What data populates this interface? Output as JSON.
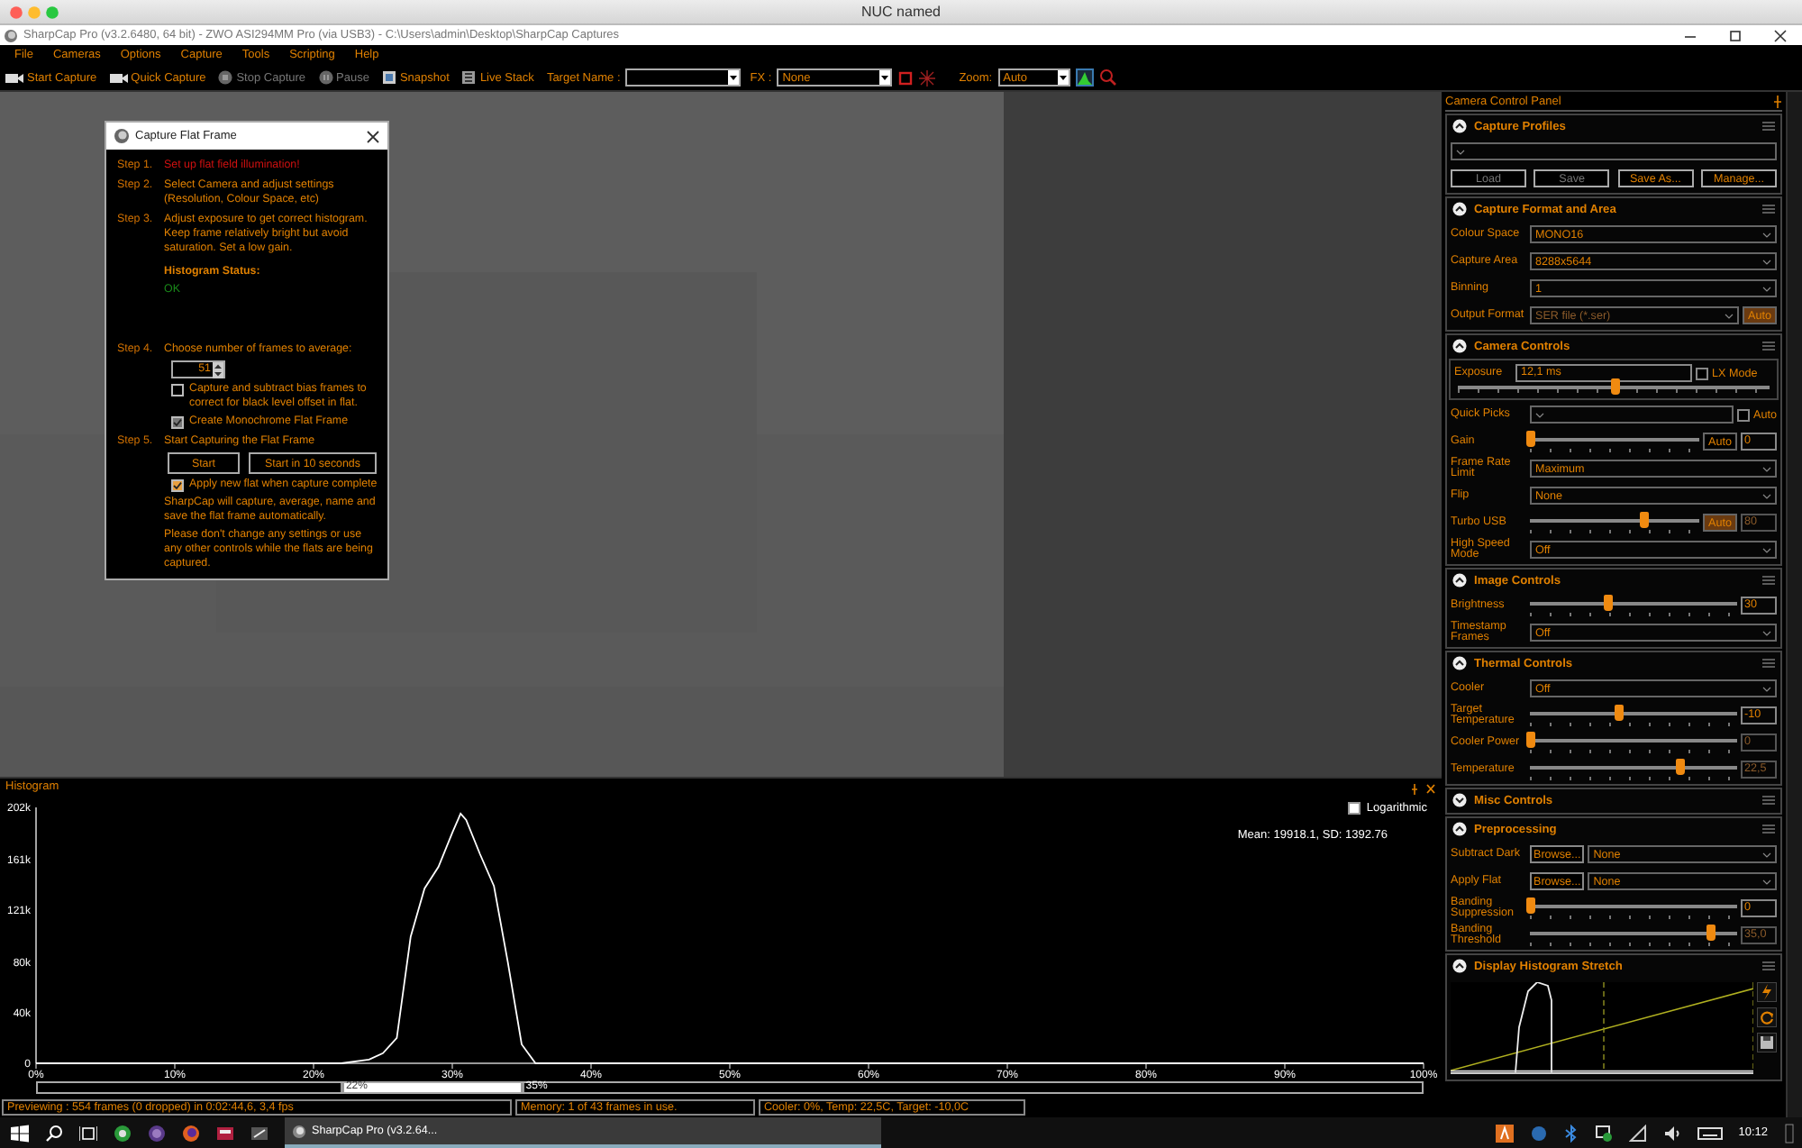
{
  "mac_title": "NUC named",
  "window": {
    "title": "SharpCap Pro (v3.2.6480, 64 bit) - ZWO ASI294MM Pro (via USB3) - C:\\Users\\admin\\Desktop\\SharpCap Captures"
  },
  "menu": [
    "File",
    "Cameras",
    "Options",
    "Capture",
    "Tools",
    "Scripting",
    "Help"
  ],
  "toolbar": {
    "buttons": [
      {
        "kind": "camera",
        "label": "Start Capture",
        "disabled": false
      },
      {
        "kind": "camera",
        "label": "Quick Capture",
        "disabled": false
      },
      {
        "kind": "stop",
        "label": "Stop Capture",
        "disabled": true
      },
      {
        "kind": "pause",
        "label": "Pause",
        "disabled": true
      },
      {
        "kind": "snapshot",
        "label": "Snapshot",
        "disabled": false
      },
      {
        "kind": "stack",
        "label": "Live Stack",
        "disabled": false
      }
    ],
    "target": {
      "label": "Target Name :"
    },
    "fx": {
      "label": "FX :",
      "value": "None"
    },
    "zoom": {
      "label": "Zoom:",
      "value": "Auto"
    }
  },
  "dialog": {
    "title": "Capture Flat Frame",
    "steps": [
      {
        "label": "Step 1.",
        "text": "Set up flat field illumination!",
        "warning": true
      },
      {
        "label": "Step 2.",
        "text": "Select Camera and adjust settings (Resolution, Colour Space, etc)",
        "warning": false
      },
      {
        "label": "Step 3.",
        "text": "Adjust exposure to get correct histogram. Keep frame relatively bright but avoid saturation. Set a low gain.",
        "warning": false,
        "status_label": "Histogram Status:",
        "status_value": "OK"
      },
      {
        "label": "Step 4.",
        "text": "Choose number of frames to average:",
        "warning": false,
        "frames": "51",
        "options": [
          {
            "label": "Capture and subtract bias frames to correct for black level offset in flat.",
            "checked": false,
            "disabled": false
          },
          {
            "label": "Create Monochrome Flat Frame",
            "checked": true,
            "disabled": true
          }
        ]
      },
      {
        "label": "Step 5.",
        "text": "Start Capturing the Flat Frame",
        "warning": false,
        "buttons": [
          "Start",
          "Start in 10 seconds"
        ],
        "options": [
          {
            "label": "Apply new flat when capture complete",
            "checked": true,
            "disabled": false
          }
        ],
        "notes": [
          "SharpCap will capture, average, name and save the flat frame automatically.",
          "Please don't change any settings or use any other controls while the flats are being captured."
        ]
      }
    ]
  },
  "histogram": {
    "title": "Histogram",
    "logarithmic": {
      "label": "Logarithmic",
      "checked": false
    },
    "stats": "Mean: 19918.1, SD: 1392.76",
    "chart_data": {
      "type": "line",
      "x": [
        0,
        22,
        24,
        25,
        26,
        27,
        28,
        29,
        30,
        30.6,
        31,
        32,
        33,
        34,
        35,
        36,
        100
      ],
      "series": [
        {
          "color": "#ffffff",
          "values": [
            0,
            0,
            3,
            8,
            20,
            100,
            138,
            155,
            182,
            197,
            192,
            165,
            140,
            80,
            15,
            0,
            0
          ]
        }
      ],
      "xlim": [
        0,
        100
      ],
      "ylim": [
        0,
        202
      ],
      "xticks": [
        {
          "value": 0,
          "label": "0%"
        },
        {
          "value": 10,
          "label": "10%"
        },
        {
          "value": 20,
          "label": "20%"
        },
        {
          "value": 30,
          "label": "30%"
        },
        {
          "value": 40,
          "label": "40%"
        },
        {
          "value": 50,
          "label": "50%"
        },
        {
          "value": 60,
          "label": "60%"
        },
        {
          "value": 70,
          "label": "70%"
        },
        {
          "value": 80,
          "label": "80%"
        },
        {
          "value": 90,
          "label": "90%"
        },
        {
          "value": 100,
          "label": "100%"
        }
      ],
      "yticks": [
        {
          "value": 0,
          "label": "0"
        },
        {
          "value": 40,
          "label": "40k"
        },
        {
          "value": 80,
          "label": "80k"
        },
        {
          "value": 121,
          "label": "121k"
        },
        {
          "value": 161,
          "label": "161k"
        },
        {
          "value": 202,
          "label": "202k"
        }
      ]
    },
    "range": {
      "start": {
        "label": "22%",
        "level": 0.22
      },
      "end": {
        "label": "35%",
        "level": 0.35
      }
    }
  },
  "status_bar": [
    "Previewing : 554 frames (0 dropped) in 0:02:44,6, 3,4 fps",
    "Memory: 1 of 43 frames in use.",
    "Cooler: 0%, Temp: 22,5C, Target: -10,0C"
  ],
  "panel": {
    "title": "Camera Control Panel",
    "sections": [
      {
        "title": "Capture Profiles",
        "expanded": true,
        "rows": [
          {
            "kind": "select",
            "disabled": false
          },
          {
            "kind": "buttons",
            "buttons": [
              {
                "label": "Load",
                "disabled": true
              },
              {
                "label": "Save",
                "disabled": true
              },
              {
                "label": "Save As...",
                "disabled": false
              },
              {
                "label": "Manage...",
                "disabled": false
              }
            ]
          }
        ]
      },
      {
        "title": "Capture Format and Area",
        "expanded": true,
        "rows": [
          {
            "kind": "select",
            "label": "Colour Space",
            "value": "MONO16",
            "disabled": false
          },
          {
            "kind": "select",
            "label": "Capture Area",
            "value": "8288x5644",
            "disabled": false
          },
          {
            "kind": "select",
            "label": "Binning",
            "value": "1",
            "disabled": false
          },
          {
            "kind": "select",
            "label": "Output Format",
            "value": "SER file (*.ser)",
            "disabled": true,
            "auto": {
              "label": "Auto",
              "on": true
            }
          }
        ]
      },
      {
        "title": "Camera Controls",
        "expanded": true,
        "rows": [
          {
            "kind": "exposure",
            "label": "Exposure",
            "value": "12,1 ms",
            "check": {
              "label": "LX Mode",
              "checked": false
            },
            "level": 0.5
          },
          {
            "kind": "select",
            "label": "Quick Picks",
            "disabled": false,
            "check": {
              "label": "Auto",
              "checked": false
            }
          },
          {
            "kind": "slider",
            "label": "Gain",
            "level": 0,
            "auto": {
              "label": "Auto",
              "on": false
            },
            "value": "0",
            "disabled": false
          },
          {
            "kind": "select",
            "label": "Frame Rate Limit",
            "value": "Maximum",
            "disabled": false
          },
          {
            "kind": "select",
            "label": "Flip",
            "value": "None",
            "disabled": false
          },
          {
            "kind": "slider",
            "label": "Turbo USB",
            "level": 0.67,
            "auto": {
              "label": "Auto",
              "on": true
            },
            "value": "80",
            "disabled": true
          },
          {
            "kind": "select",
            "label": "High Speed Mode",
            "value": "Off",
            "disabled": false
          }
        ]
      },
      {
        "title": "Image Controls",
        "expanded": true,
        "rows": [
          {
            "kind": "slider",
            "label": "Brightness",
            "level": 0.37,
            "value": "30",
            "disabled": false
          },
          {
            "kind": "select",
            "label": "Timestamp Frames",
            "value": "Off",
            "disabled": false
          }
        ]
      },
      {
        "title": "Thermal Controls",
        "expanded": true,
        "rows": [
          {
            "kind": "select",
            "label": "Cooler",
            "value": "Off",
            "disabled": false
          },
          {
            "kind": "slider",
            "label": "Target Temperature",
            "level": 0.43,
            "value": "-10",
            "disabled": false
          },
          {
            "kind": "slider",
            "label": "Cooler Power",
            "level": 0,
            "value": "0",
            "disabled": true
          },
          {
            "kind": "slider",
            "label": "Temperature",
            "level": 0.72,
            "value": "22,5",
            "disabled": true
          }
        ]
      },
      {
        "title": "Misc Controls",
        "expanded": false
      },
      {
        "title": "Preprocessing",
        "expanded": true,
        "rows": [
          {
            "kind": "browse",
            "label": "Subtract Dark",
            "button": "Browse...",
            "value": "None"
          },
          {
            "kind": "browse",
            "label": "Apply Flat",
            "button": "Browse...",
            "value": "None"
          },
          {
            "kind": "slider",
            "label": "Banding Suppression",
            "level": 0,
            "value": "0",
            "disabled": false
          },
          {
            "kind": "slider",
            "label": "Banding Threshold",
            "level": 0.87,
            "value": "35,0",
            "disabled": true
          }
        ]
      },
      {
        "title": "Display Histogram Stretch",
        "expanded": true,
        "rows": [
          {
            "kind": "stretch"
          }
        ]
      }
    ]
  },
  "taskbar": {
    "window": {
      "label": "SharpCap Pro (v3.2.64...",
      "selected": true
    },
    "time": "10:12"
  }
}
